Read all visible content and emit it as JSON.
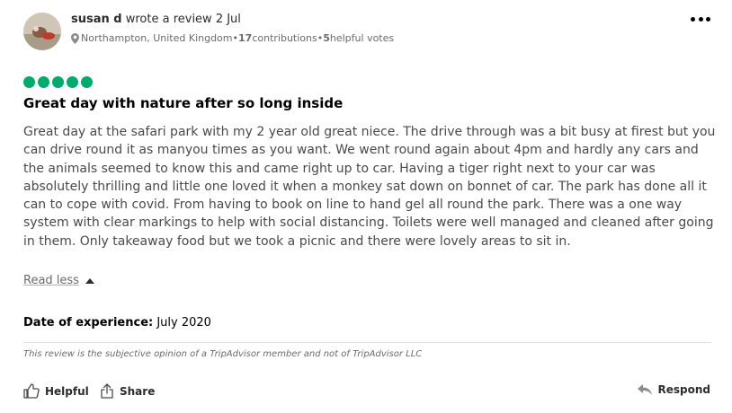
{
  "author": {
    "name": "susan d",
    "action": " wrote a review 2 Jul"
  },
  "meta": {
    "location": "Northampton, United Kingdom",
    "sep1": " • ",
    "contributions_count": "17",
    "contributions_label": " contributions",
    "sep2": " • ",
    "helpful_count": "5",
    "helpful_label": " helpful votes"
  },
  "rating": {
    "value": 5,
    "max": 5,
    "color": "#00aa6c"
  },
  "review": {
    "title": "Great day with nature after so long inside",
    "body": "Great day at the safari park with my 2 year old great niece. The drive through was a bit busy at firest but you can drive round it as manyou times as you want. We went round again about 4pm and hardly any cars and the animals seemed to know this and came right up to car. Having a tiger right next to your car was absolutely thrilling and little one loved it when a monkey sat down on bonnet of car. The park has done all it can to cope with covid. From having to book on line to hand gel all round the park. There was a one way system with clear markings to help with social distancing. Toilets were well managed and cleaned after going in them. Only takeaway food but we took a picnic and there were lovely areas to sit in.",
    "read_less": "Read less"
  },
  "experience": {
    "label": "Date of experience:",
    "value": " July 2020"
  },
  "disclaimer": "This review is the subjective opinion of a TripAdvisor member and not of TripAdvisor LLC",
  "actions": {
    "helpful": "Helpful",
    "share": "Share",
    "respond": "Respond"
  },
  "icons": {
    "more": "more-options-icon",
    "location": "location-pin-icon",
    "read_less": "caret-up-icon",
    "helpful": "thumbs-up-icon",
    "share": "share-icon",
    "respond": "reply-arrow-icon"
  }
}
